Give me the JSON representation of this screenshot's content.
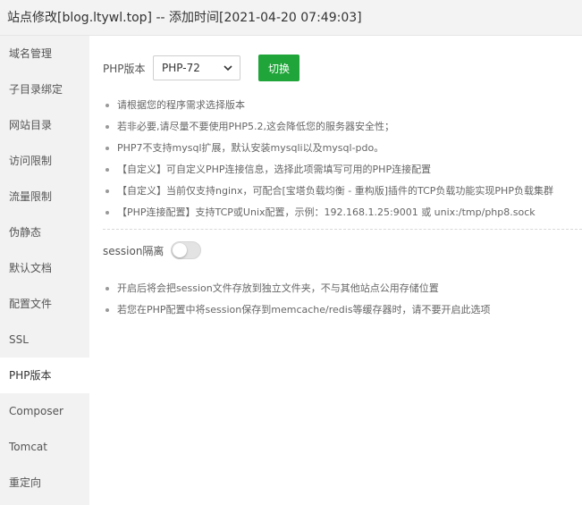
{
  "title": "站点修改[blog.ltywl.top] -- 添加时间[2021-04-20 07:49:03]",
  "sidebar": {
    "items": [
      {
        "label": "域名管理",
        "active": false
      },
      {
        "label": "子目录绑定",
        "active": false
      },
      {
        "label": "网站目录",
        "active": false
      },
      {
        "label": "访问限制",
        "active": false
      },
      {
        "label": "流量限制",
        "active": false
      },
      {
        "label": "伪静态",
        "active": false
      },
      {
        "label": "默认文档",
        "active": false
      },
      {
        "label": "配置文件",
        "active": false
      },
      {
        "label": "SSL",
        "active": false
      },
      {
        "label": "PHP版本",
        "active": true
      },
      {
        "label": "Composer",
        "active": false
      },
      {
        "label": "Tomcat",
        "active": false
      },
      {
        "label": "重定向",
        "active": false
      }
    ]
  },
  "php": {
    "label": "PHP版本",
    "selected": "PHP-72",
    "switch_label": "切换"
  },
  "notes": [
    "请根据您的程序需求选择版本",
    "若非必要,请尽量不要使用PHP5.2,这会降低您的服务器安全性；",
    "PHP7不支持mysql扩展，默认安装mysqli以及mysql-pdo。",
    "【自定义】可自定义PHP连接信息，选择此项需填写可用的PHP连接配置",
    "【自定义】当前仅支持nginx，可配合[宝塔负载均衡 - 重构版]插件的TCP负载功能实现PHP负载集群",
    "【PHP连接配置】支持TCP或Unix配置，示例：192.168.1.25:9001 或 unix:/tmp/php8.sock"
  ],
  "session": {
    "label": "session隔离",
    "enabled": false,
    "notes": [
      "开启后将会把session文件存放到独立文件夹，不与其他站点公用存储位置",
      "若您在PHP配置中将session保存到memcache/redis等缓存器时，请不要开启此选项"
    ]
  },
  "colors": {
    "accent": "#20a53a",
    "sidebar_bg": "#f2f2f2",
    "titlebar_bg": "#f3f3f3"
  }
}
